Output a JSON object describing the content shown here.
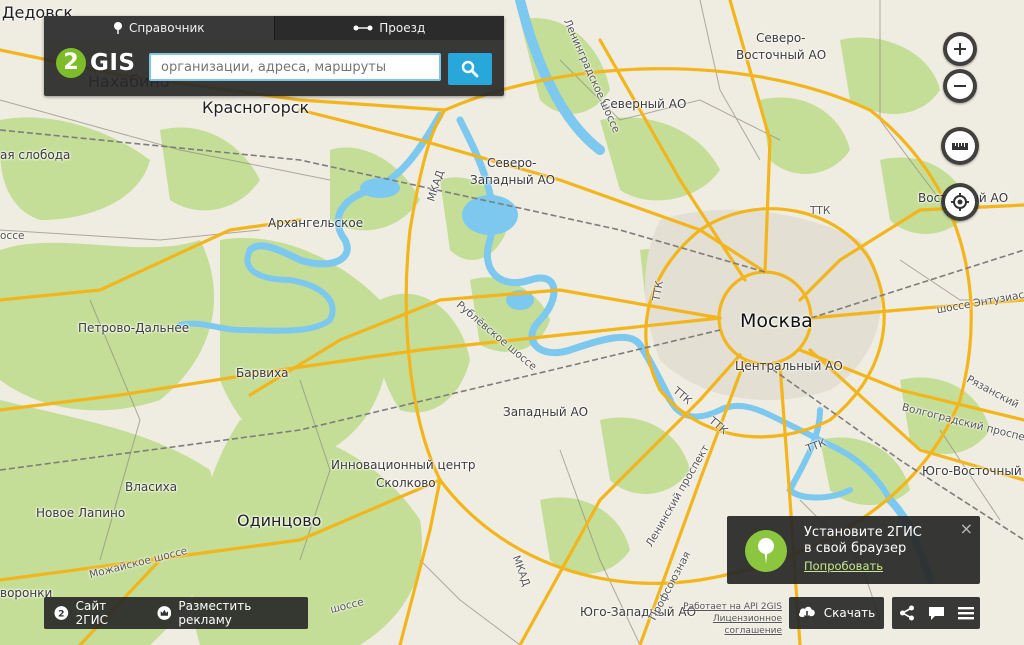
{
  "search": {
    "tab_directory": "Справочник",
    "tab_route": "Проезд",
    "logo_digit": "2",
    "logo_text": "GIS",
    "placeholder": "организации, адреса, маршруты"
  },
  "map_labels": {
    "dedovsk": "Дедовск",
    "nakhabino": "Нахабино",
    "krasnogorsk": "Красногорск",
    "sloboda": "ая слобода",
    "arkhangelskoe": "Архангельское",
    "shosse_left": "оссе",
    "petrovo": "Петрово-Дальнее",
    "barvikha": "Барвиха",
    "vlasikha": "Власиха",
    "lapino": "Новое Лапино",
    "odintsovo": "Одинцово",
    "mozhaysk": "Можайское шоссе",
    "voronki": "воронки",
    "innovation1": "Инновационный центр",
    "innovation2": "Сколково",
    "zapadny": "Западный АО",
    "sz1": "Северо-",
    "sz2": "Западный АО",
    "severny": "Северный АО",
    "sv1": "Северо-",
    "sv2": "Восточный АО",
    "vostochny": "Восточный АО",
    "moskva": "Москва",
    "centralny": "Центральный АО",
    "yuv": "Юго-Восточный",
    "yuz": "Юго-Западный АО",
    "leningradskoe": "Ленинградское шоссе",
    "rublevskoe": "Рублёвское шоссе",
    "mkad1": "МКАД",
    "mkad2": "МКАД",
    "leninsky": "Ленинский проспект",
    "profsoyuznaya": "Профсоюзная",
    "ryazansky": "Рязанский",
    "volgogradsky": "Волгоградский проспект",
    "entuziastov": "шоссе Энтузиастов",
    "ttk1": "ТТК",
    "ttk2": "ТТК",
    "ttk3": "ТТК",
    "ttk4": "ТТК",
    "ttk5": "ТТК",
    "shosse_bottom": "шоссе"
  },
  "bottom_left": {
    "site": "Сайт 2ГИС",
    "advertise": "Разместить рекламу"
  },
  "promo": {
    "line1": "Установите 2ГИС",
    "line2": "в свой браузер",
    "link": "Попробовать",
    "close": "×"
  },
  "download": {
    "label": "Скачать"
  },
  "api": {
    "line1": "Работает на API 2GIS",
    "line2": "Лицензионное соглашение"
  },
  "colors": {
    "accent": "#28a7db",
    "brand": "#7dbd2a",
    "roads": "#f5b91f",
    "water": "#6fc3ec",
    "park": "#c6e09c"
  }
}
